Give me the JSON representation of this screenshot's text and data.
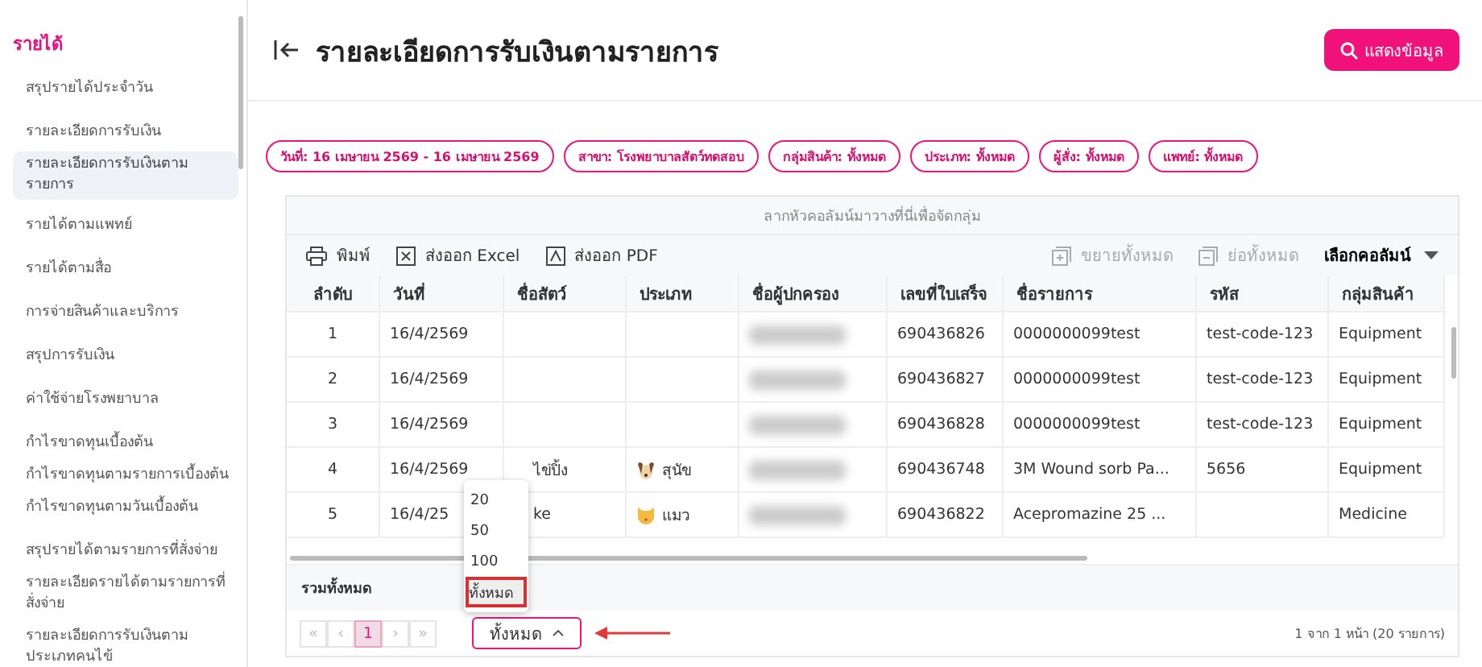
{
  "sidebar": {
    "heading": "รายได้",
    "items": [
      {
        "label": "สรุปรายได้ประจำวัน",
        "selected": false
      },
      {
        "label": "รายละเอียดการรับเงิน",
        "selected": false
      },
      {
        "label": "รายละเอียดการรับเงินตามรายการ",
        "selected": true
      },
      {
        "label": "รายได้ตามแพทย์",
        "selected": false
      },
      {
        "label": "รายได้ตามสื่อ",
        "selected": false
      },
      {
        "label": "การจ่ายสินค้าและบริการ",
        "selected": false
      },
      {
        "label": "สรุปการรับเงิน",
        "selected": false
      },
      {
        "label": "ค่าใช้จ่ายโรงพยาบาล",
        "selected": false
      },
      {
        "label": "กำไรขาดทุนเบื้องต้น",
        "selected": false
      },
      {
        "label": "กำไรขาดทุนตามรายการเบื้องต้น",
        "selected": false
      },
      {
        "label": "กำไรขาดทุนตามวันเบื้องต้น",
        "selected": false
      },
      {
        "label": "สรุปรายได้ตามรายการที่สั่งจ่าย",
        "selected": false
      },
      {
        "label": "รายละเอียดรายได้ตามรายการที่สั่งจ่าย",
        "selected": false
      },
      {
        "label": "รายละเอียดการรับเงินตามประเภทคนไข้",
        "selected": false
      }
    ]
  },
  "header": {
    "title": "รายละเอียดการรับเงินตามรายการ",
    "button": "แสดงข้อมูล"
  },
  "filters": [
    "วันที่: 16 เมษายน 2569 - 16 เมษายน 2569",
    "สาขา: โรงพยาบาลสัตว์ทดสอบ",
    "กลุ่มสินค้า: ทั้งหมด",
    "ประเภท: ทั้งหมด",
    "ผู้สั่ง: ทั้งหมด",
    "แพทย์: ทั้งหมด"
  ],
  "table": {
    "group_hint": "ลากหัวคอลัมน์มาวางที่นี่เพื่อจัดกลุ่ม",
    "toolbar": [
      {
        "label": "พิมพ์",
        "kind": "print",
        "disabled": false
      },
      {
        "label": "ส่งออก Excel",
        "kind": "excel",
        "disabled": false
      },
      {
        "label": "ส่งออก PDF",
        "kind": "pdf",
        "disabled": false
      }
    ],
    "toolbar_right": [
      {
        "label": "ขยายทั้งหมด",
        "kind": "expand",
        "disabled": true
      },
      {
        "label": "ย่อทั้งหมด",
        "kind": "collapse",
        "disabled": true
      }
    ],
    "column_chooser": "เลือกคอลัมน์",
    "columns": [
      "ลำดับ",
      "วันที่",
      "ชื่อสัตว์",
      "ประเภท",
      "ชื่อผู้ปกครอง",
      "เลขที่ใบเสร็จ",
      "ชื่อรายการ",
      "รหัส",
      "กลุ่มสินค้า"
    ],
    "rows": [
      {
        "no": "1",
        "date": "16/4/2569",
        "guardian_redacted": true,
        "receipt": "690436826",
        "item": "0000000099test",
        "code": "test-code-123",
        "group": "Equipment"
      },
      {
        "no": "2",
        "date": "16/4/2569",
        "guardian_redacted": true,
        "receipt": "690436827",
        "item": "0000000099test",
        "code": "test-code-123",
        "group": "Equipment"
      },
      {
        "no": "3",
        "date": "16/4/2569",
        "guardian_redacted": true,
        "receipt": "690436828",
        "item": "0000000099test",
        "code": "test-code-123",
        "group": "Equipment"
      },
      {
        "no": "4",
        "date": "16/4/2569",
        "pet": "ไข่ปิ้ง",
        "type": {
          "label": "สุนัข",
          "kind": "dog"
        },
        "guardian_redacted": true,
        "receipt": "690436748",
        "item": "3M Wound sorb Pa...",
        "code": "5656",
        "group": "Equipment"
      },
      {
        "no": "5",
        "date": "16/4/25",
        "pet": "ke",
        "type": {
          "label": "แมว",
          "kind": "cat"
        },
        "guardian_redacted": true,
        "receipt": "690436822",
        "item": "Acepromazine 25 ...",
        "group": "Medicine"
      }
    ],
    "total_label": "รวมทั้งหมด"
  },
  "pager": {
    "buttons": [
      {
        "label": "«",
        "kind": "nav",
        "selected": false
      },
      {
        "label": "‹",
        "kind": "nav",
        "selected": false
      },
      {
        "label": "1",
        "kind": "page",
        "selected": true
      },
      {
        "label": "›",
        "kind": "nav",
        "selected": false
      },
      {
        "label": "»",
        "kind": "nav",
        "selected": false
      }
    ],
    "page_size": "ทั้งหมด",
    "page_size_open": true,
    "page_size_options": [
      {
        "label": "20",
        "selected": false
      },
      {
        "label": "50",
        "selected": false
      },
      {
        "label": "100",
        "selected": false
      },
      {
        "label": "ทั้งหมด",
        "selected": true
      }
    ],
    "summary": "1 จาก 1 หน้า (20 รายการ)"
  }
}
